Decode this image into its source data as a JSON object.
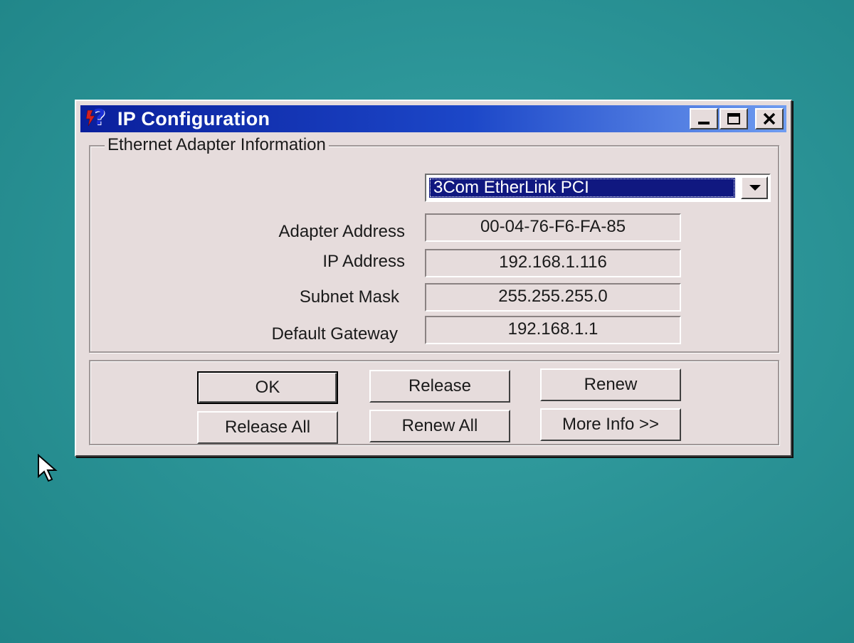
{
  "window": {
    "title": "IP Configuration"
  },
  "adapter_group": {
    "legend": "Ethernet  Adapter Information",
    "selected_adapter": "3Com EtherLink PCI",
    "fields": [
      {
        "label": "Adapter Address",
        "value": "00-04-76-F6-FA-85"
      },
      {
        "label": "IP Address",
        "value": "192.168.1.116"
      },
      {
        "label": "Subnet Mask",
        "value": "255.255.255.0"
      },
      {
        "label": "Default Gateway",
        "value": "192.168.1.1"
      }
    ]
  },
  "buttons": {
    "ok": "OK",
    "release": "Release",
    "renew": "Renew",
    "release_all": "Release All",
    "renew_all": "Renew All",
    "more_info": "More Info >>"
  },
  "icons": {
    "app": "network-help-icon",
    "minimize": "minimize-icon",
    "maximize": "maximize-icon",
    "close": "close-icon",
    "dropdown": "chevron-down-icon",
    "pointer": "mouse-cursor-icon"
  },
  "colors": {
    "desktop": "#2c9598",
    "titlebar_start": "#0a1f9c",
    "titlebar_end": "#6f9cf0",
    "selection": "#101880"
  }
}
